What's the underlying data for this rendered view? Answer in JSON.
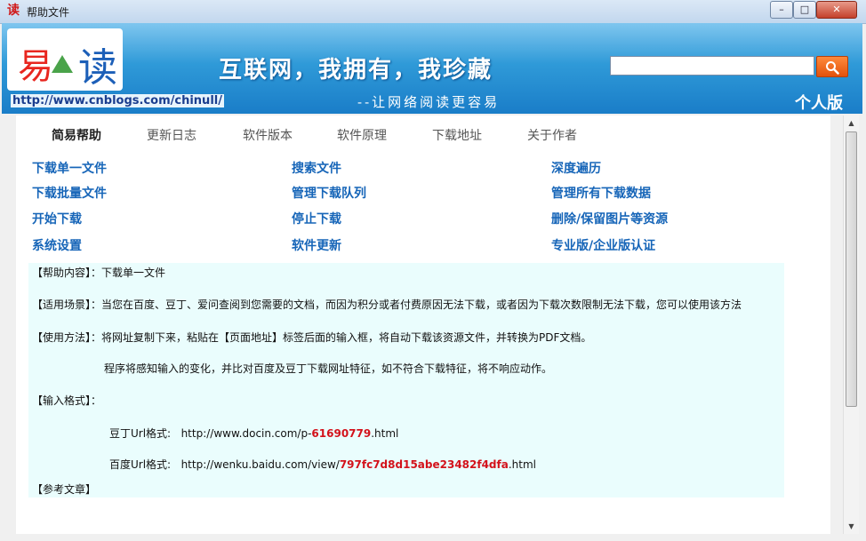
{
  "window": {
    "title": "帮助文件",
    "icon": "读",
    "controls": [
      "–",
      "□",
      "✕"
    ]
  },
  "banner": {
    "logo_chars": [
      "易",
      "读"
    ],
    "slogan": "互联网，我拥有，我珍藏",
    "subslogan": "--让网络阅读更容易",
    "url": "http://www.cnblogs.com/chinull/",
    "edition": "个人版",
    "search": {
      "value": "",
      "placeholder": ""
    }
  },
  "tabs": [
    {
      "label": "简易帮助",
      "active": true
    },
    {
      "label": "更新日志",
      "active": false
    },
    {
      "label": "软件版本",
      "active": false
    },
    {
      "label": "软件原理",
      "active": false
    },
    {
      "label": "下载地址",
      "active": false
    },
    {
      "label": "关于作者",
      "active": false
    }
  ],
  "links": [
    [
      "下载单一文件",
      "搜索文件",
      "深度遍历"
    ],
    [
      "下载批量文件",
      "管理下载队列",
      "管理所有下载数据"
    ],
    [
      "开始下载",
      "停止下载",
      "删除/保留图片等资源"
    ],
    [
      "系统设置",
      "软件更新",
      "专业版/企业版认证"
    ]
  ],
  "help": {
    "content": "【帮助内容】：下载单一文件",
    "scenario": "【适用场景】：当您在百度、豆丁、爱问查阅到您需要的文档，而因为积分或者付费原因无法下载，或者因为下载次数限制无法下载，您可以使用该方法",
    "usage": "【使用方法】：将网址复制下来，粘贴在【页面地址】标签后面的输入框，将自动下载该资源文件，并转换为PDF文档。",
    "usage_note": "程序将感知输入的变化，并比对百度及豆丁下载网址特征，如不符合下载特征，将不响应动作。",
    "format_title": "【输入格式】：",
    "docin": {
      "label": "豆丁Url格式:",
      "prefix": "http://www.docin.com/p-",
      "id": "61690779",
      "suffix": ".html"
    },
    "baidu": {
      "label": "百度Url格式:",
      "prefix": "http://wenku.baidu.com/view/",
      "id": "797fc7d8d15abe23482f4dfa",
      "suffix": ".html"
    },
    "reference": "【参考文章】"
  },
  "colors": {
    "link": "#1665b8",
    "panel": "#eafdfd",
    "highlight": "#d3121b",
    "search_button": "#e2520d"
  }
}
